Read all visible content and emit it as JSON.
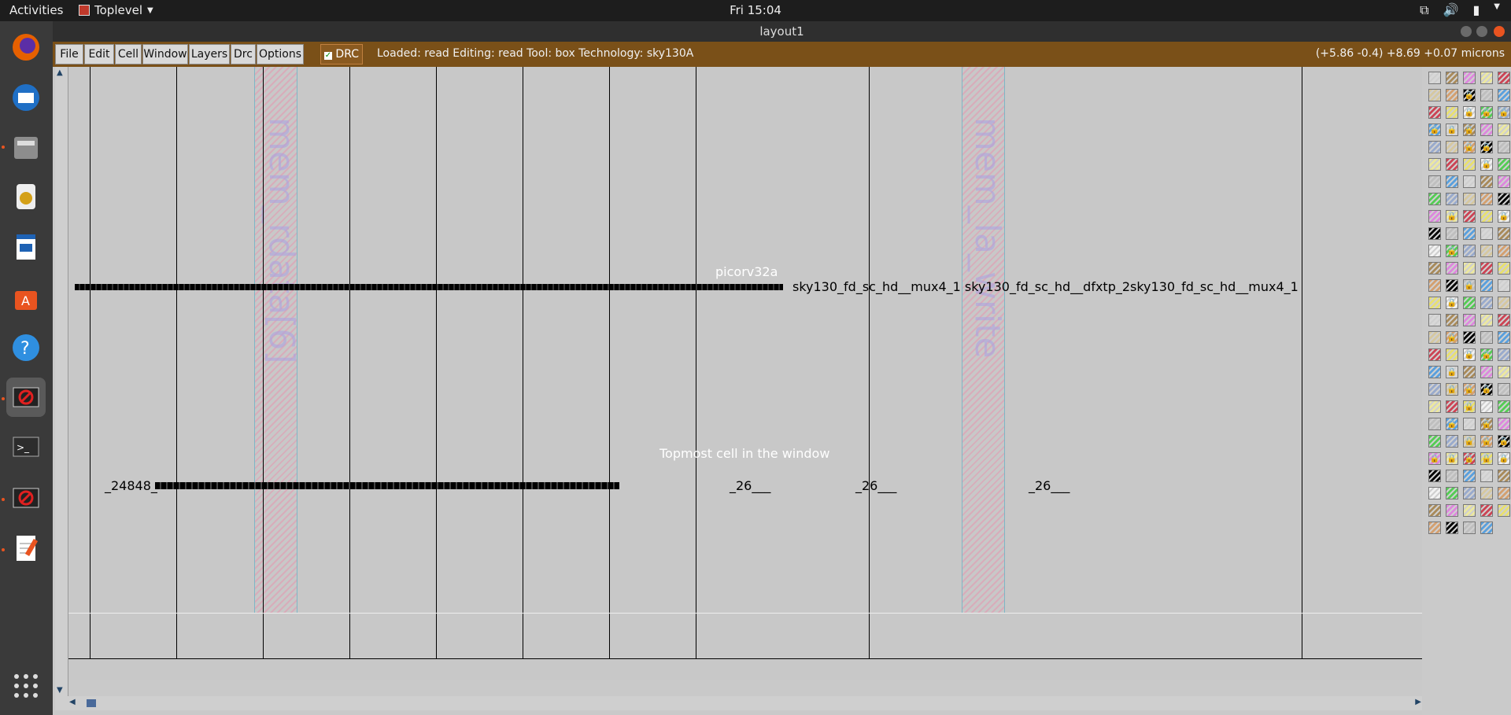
{
  "topbar": {
    "activities": "Activities",
    "app_name": "Toplevel",
    "clock": "Fri 15:04"
  },
  "window": {
    "title": "layout1"
  },
  "menu": {
    "items": [
      "File",
      "Edit",
      "Cell",
      "Window",
      "Layers",
      "Drc",
      "Options"
    ],
    "drc_toggle": "DRC"
  },
  "status": {
    "text": "Loaded: read Editing: read Tool: box  Technology: sky130A",
    "coords": "(+5.86 -0.4) +8.69 +0.07 microns"
  },
  "canvas": {
    "top_cell_label": "picorv32a",
    "topmost_hint": "Topmost cell in the window",
    "hatched_labels": [
      "mem_rdata[6]",
      "mem_la_write"
    ],
    "instance_row_1": "sky130_fd_sc_hd__mux4_1  sky130_fd_sc_hd__dfxtp_2sky130_fd_sc_hd__mux4_1",
    "instance_row_2": [
      "_24848_",
      "_26___",
      "_26___",
      "_26___"
    ]
  },
  "colors": {
    "menubar": "#7a5018",
    "canvas": "#c8c8c8",
    "accent": "#e95420"
  }
}
